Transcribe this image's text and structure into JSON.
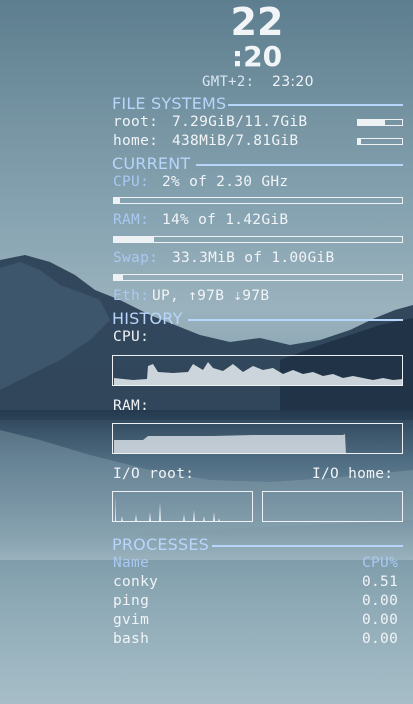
{
  "clock": {
    "hour": "22",
    "minute": ":20",
    "zone_label": "GMT+2:",
    "zone_time": "23:20"
  },
  "file_systems": {
    "heading": "FILE SYSTEMS",
    "items": [
      {
        "label": "root:",
        "value": "7.29GiB/11.7GiB",
        "usage": 0.62
      },
      {
        "label": "home:",
        "value": "438MiB/7.81GiB",
        "usage": 0.06
      }
    ]
  },
  "current": {
    "heading": "CURRENT",
    "cpu": {
      "label": "CPU:",
      "value": "2% of 2.30 GHz",
      "usage": 0.02
    },
    "ram": {
      "label": "RAM:",
      "value": "14% of 1.42GiB",
      "usage": 0.14
    },
    "swap": {
      "label": "Swap:",
      "value": "33.3MiB of 1.00GiB",
      "usage": 0.03
    },
    "eth": {
      "label": "Eth:",
      "value": "UP, ↑97B ⇣97B"
    }
  },
  "history": {
    "heading": "HISTORY",
    "cpu_label": "CPU:",
    "ram_label": "RAM:",
    "io_root_label": "I/O root:",
    "io_home_label": "I/O home:"
  },
  "processes": {
    "heading": "PROCESSES",
    "col_name": "Name",
    "col_cpu": "CPU%",
    "rows": [
      {
        "name": "conky",
        "cpu": "0.51"
      },
      {
        "name": "ping",
        "cpu": "0.00"
      },
      {
        "name": "gvim",
        "cpu": "0.00"
      },
      {
        "name": "bash",
        "cpu": "0.00"
      }
    ]
  },
  "colors": {
    "heading": "#b8d6fb",
    "label": "#a9c9f2",
    "text": "#f1f4f7"
  }
}
